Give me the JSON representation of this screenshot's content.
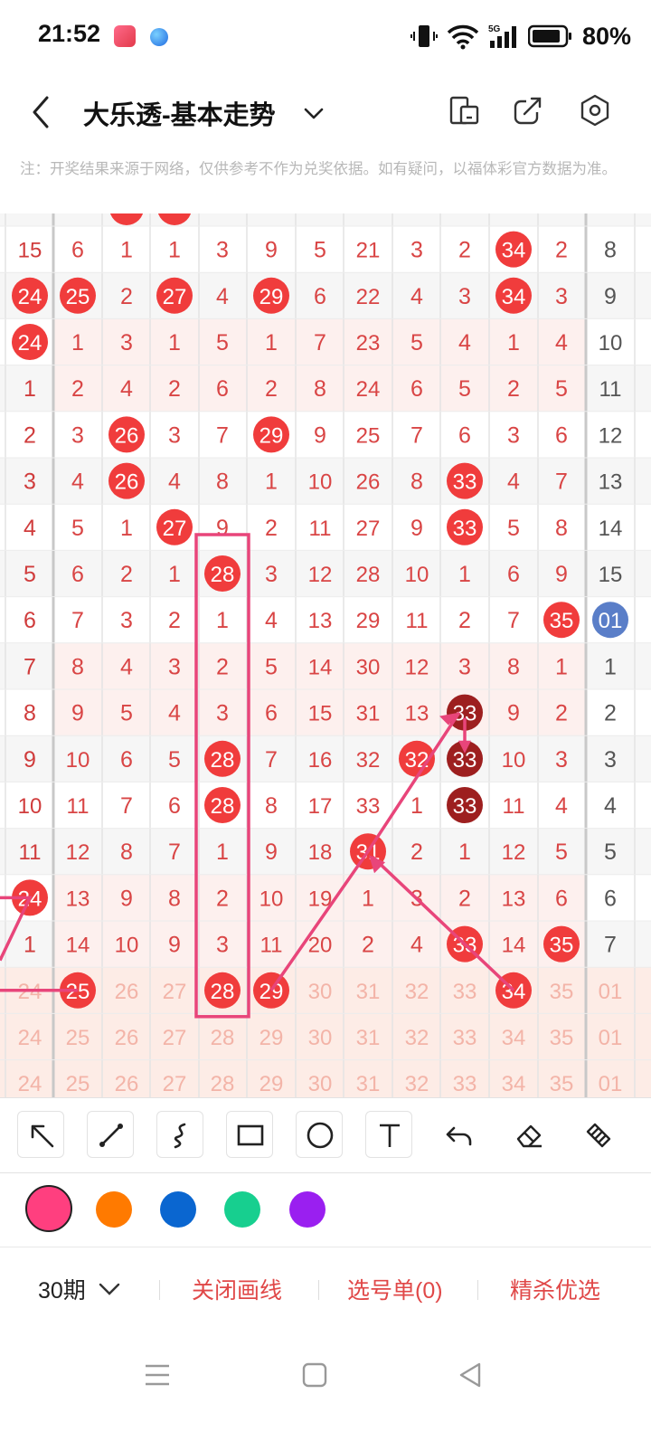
{
  "status_bar": {
    "time": "21:52",
    "battery": "80%",
    "network": "5G"
  },
  "header": {
    "title": "大乐透-基本走势"
  },
  "notice": "注：开奖结果来源于网络，仅供参考不作为兑奖依据。如有疑问，以福体彩官方数据为准。",
  "chart_rows": [
    {
      "cells": [
        "15",
        "6",
        "1",
        "1",
        "3",
        "9",
        "5",
        "21",
        "3",
        "2",
        "34",
        "2",
        "8"
      ]
    },
    {
      "cells": [
        "24",
        "25",
        "2",
        "27",
        "4",
        "29",
        "6",
        "22",
        "4",
        "3",
        "34",
        "3",
        "9"
      ]
    },
    {
      "cells": [
        "24",
        "1",
        "3",
        "1",
        "5",
        "1",
        "7",
        "23",
        "5",
        "4",
        "1",
        "4",
        "10"
      ]
    },
    {
      "cells": [
        "1",
        "2",
        "4",
        "2",
        "6",
        "2",
        "8",
        "24",
        "6",
        "5",
        "2",
        "5",
        "11"
      ]
    },
    {
      "cells": [
        "2",
        "3",
        "26",
        "3",
        "7",
        "29",
        "9",
        "25",
        "7",
        "6",
        "3",
        "6",
        "12"
      ]
    },
    {
      "cells": [
        "3",
        "4",
        "26",
        "4",
        "8",
        "1",
        "10",
        "26",
        "8",
        "33",
        "4",
        "7",
        "13"
      ]
    },
    {
      "cells": [
        "4",
        "5",
        "1",
        "27",
        "9",
        "2",
        "11",
        "27",
        "9",
        "33",
        "5",
        "8",
        "14"
      ]
    },
    {
      "cells": [
        "5",
        "6",
        "2",
        "1",
        "28",
        "3",
        "12",
        "28",
        "10",
        "1",
        "6",
        "9",
        "15"
      ]
    },
    {
      "cells": [
        "6",
        "7",
        "3",
        "2",
        "1",
        "4",
        "13",
        "29",
        "11",
        "2",
        "7",
        "35",
        "01"
      ]
    },
    {
      "cells": [
        "7",
        "8",
        "4",
        "3",
        "2",
        "5",
        "14",
        "30",
        "12",
        "3",
        "8",
        "1",
        "1"
      ]
    },
    {
      "cells": [
        "8",
        "9",
        "5",
        "4",
        "3",
        "6",
        "15",
        "31",
        "13",
        "33",
        "9",
        "2",
        "2"
      ]
    },
    {
      "cells": [
        "9",
        "10",
        "6",
        "5",
        "28",
        "7",
        "16",
        "32",
        "32",
        "33",
        "10",
        "3",
        "3"
      ]
    },
    {
      "cells": [
        "10",
        "11",
        "7",
        "6",
        "28",
        "8",
        "17",
        "33",
        "1",
        "33",
        "11",
        "4",
        "4"
      ]
    },
    {
      "cells": [
        "11",
        "12",
        "8",
        "7",
        "1",
        "9",
        "18",
        "31",
        "2",
        "1",
        "12",
        "5",
        "5"
      ]
    },
    {
      "cells": [
        "24",
        "13",
        "9",
        "8",
        "2",
        "10",
        "19",
        "1",
        "3",
        "2",
        "13",
        "6",
        "6"
      ]
    },
    {
      "cells": [
        "1",
        "14",
        "10",
        "9",
        "3",
        "11",
        "20",
        "2",
        "4",
        "33",
        "14",
        "35",
        "7"
      ]
    },
    {
      "cells": [
        "24",
        "25",
        "26",
        "27",
        "28",
        "29",
        "30",
        "31",
        "32",
        "33",
        "34",
        "35",
        "01"
      ]
    },
    {
      "cells": [
        "24",
        "25",
        "26",
        "27",
        "28",
        "29",
        "30",
        "31",
        "32",
        "33",
        "34",
        "35",
        "01"
      ]
    },
    {
      "cells": [
        "24",
        "25",
        "26",
        "27",
        "28",
        "29",
        "30",
        "31",
        "32",
        "33",
        "34",
        "35",
        "01"
      ]
    }
  ],
  "tools": [
    {
      "icon": "arrow-tool-icon"
    },
    {
      "icon": "line-tool-icon"
    },
    {
      "icon": "freehand-tool-icon"
    },
    {
      "icon": "rectangle-tool-icon"
    },
    {
      "icon": "circle-tool-icon"
    },
    {
      "icon": "text-tool-icon"
    },
    {
      "icon": "undo-icon"
    },
    {
      "icon": "eraser-icon"
    },
    {
      "icon": "clear-icon"
    }
  ],
  "colors": [
    "#ff3f7f",
    "#ff7a00",
    "#0a66d0",
    "#17cf8f",
    "#9a1ff0"
  ],
  "bottom_bar": {
    "period": "30期",
    "close_drawing": "关闭画线",
    "selection": "选号单(0)",
    "picks": "精杀优选"
  },
  "theme": {
    "red": "#f03c3c",
    "dark_red": "#9d1f1f",
    "blue": "#5a7ec8",
    "pink": "#e8457a",
    "text_red": "#e04848"
  }
}
